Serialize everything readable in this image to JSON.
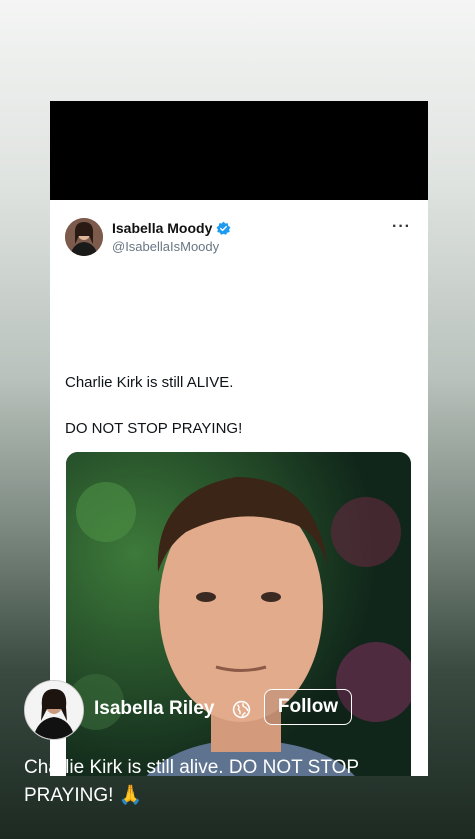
{
  "tweet": {
    "author_name": "Isabella Moody",
    "handle": "@IsabellaIsMoody",
    "more_label": "···",
    "line1": "Charlie Kirk is still ALIVE.",
    "line2": "DO NOT STOP PRAYING!"
  },
  "post": {
    "author_name": "Isabella Riley",
    "follow_label": "Follow",
    "caption": "Charlie Kirk is still alive. DO NOT STOP PRAYING! 🙏"
  },
  "colors": {
    "verified": "#1d9bf0",
    "handle": "#687684",
    "frame": "#000000"
  },
  "icons": [
    "verified-badge-icon",
    "more-options-icon",
    "globe-icon"
  ]
}
